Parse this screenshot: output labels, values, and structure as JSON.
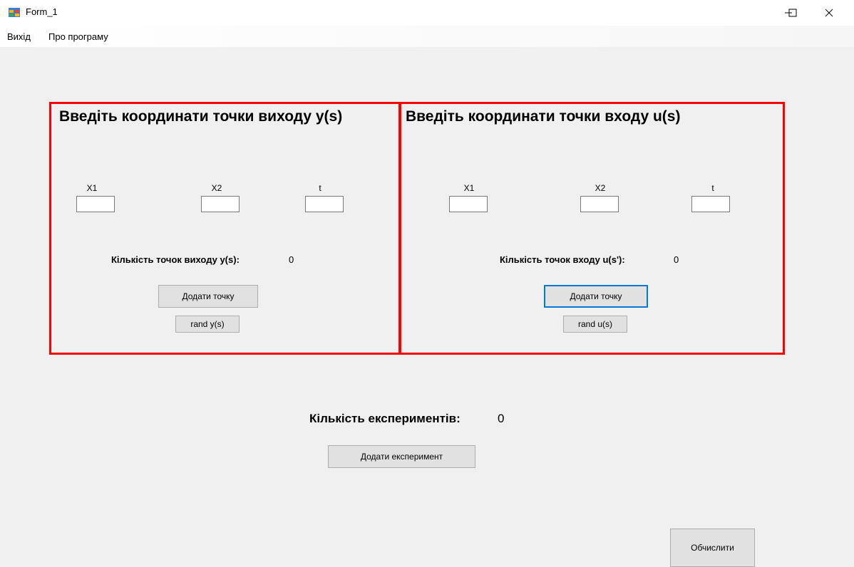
{
  "window": {
    "title": "Form_1"
  },
  "menu": {
    "exit": "Вихід",
    "about": "Про програму"
  },
  "output_panel": {
    "heading": "Введіть координати точки виходу y(s)",
    "x1_label": "X1",
    "x2_label": "X2",
    "t_label": "t",
    "x1_value": "",
    "x2_value": "",
    "t_value": "",
    "count_label": "Кількість точок виходу y(s):",
    "count_value": "0",
    "add_button": "Додати точку",
    "rand_button": "rand y(s)"
  },
  "input_panel": {
    "heading": "Введіть координати точки входу u(s)",
    "x1_label": "X1",
    "x2_label": "X2",
    "t_label": "t",
    "x1_value": "",
    "x2_value": "",
    "t_value": "",
    "count_label": "Кількість точок входу u(s'):",
    "count_value": "0",
    "add_button": "Додати точку",
    "rand_button": "rand u(s)"
  },
  "experiments": {
    "count_label": "Кількість експериментів:",
    "count_value": "0",
    "add_button": "Додати експеримент"
  },
  "calculate_button": "Обчислити",
  "colors": {
    "panel_border": "#ff0000",
    "focus": "#0078d7",
    "background": "#f0f0f0"
  }
}
